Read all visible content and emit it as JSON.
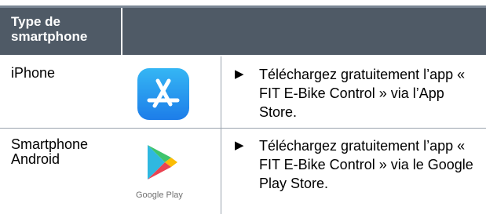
{
  "header": {
    "type_heading": "Type de smartphone",
    "second_heading": ""
  },
  "rows": [
    {
      "type": "iPhone",
      "icon": "app-store-icon",
      "arrow": "▶",
      "instruction": "Téléchargez gratuitement l’app « FIT E-Bike Control » via l’App Store."
    },
    {
      "type": "Smartphone Android",
      "icon": "google-play-icon",
      "icon_caption": "Google Play",
      "arrow": "▶",
      "instruction": "Téléchargez gratuitement l’app « FIT E-Bike Control » via le Google Play Store."
    }
  ],
  "colors": {
    "header_bg": "#4f5a66",
    "top_rule": "#7b8795",
    "grid_lines": "#9aa3ad",
    "appstore_gradient_top": "#35b6f4",
    "appstore_gradient_bottom": "#1d7de9"
  }
}
